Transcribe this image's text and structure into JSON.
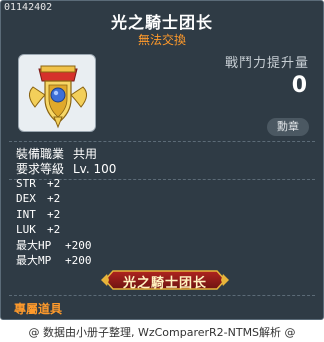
{
  "tooltip": {
    "item_code": "01142402",
    "title": "光之騎士团长",
    "trade_status": "無法交換",
    "power_label": "戰鬥力提升量",
    "power_value": "0",
    "badge_label": "勳章",
    "requirements": {
      "job_label": "裝備職業",
      "job_value": "共用",
      "level_label": "要求等級",
      "level_value": "Lv. 100"
    },
    "stats": [
      {
        "key": "STR",
        "value": "+2"
      },
      {
        "key": "DEX",
        "value": "+2"
      },
      {
        "key": "INT",
        "value": "+2"
      },
      {
        "key": "LUK",
        "value": "+2"
      },
      {
        "key": "最大HP",
        "value": "+200"
      },
      {
        "key": "最大MP",
        "value": "+200"
      }
    ],
    "title_plate_text": "光之騎士团长",
    "exclusive_label": "專屬道具"
  },
  "footer": {
    "credit": "@ 数据由小册子整理, WzComparerR2-NTMS解析 @"
  },
  "colors": {
    "panel_bg": "#2f3b45",
    "accent_orange": "#ff9a2b",
    "text_white": "#ffffff"
  },
  "icons": {
    "item": "knight-medal-icon",
    "title_plate": "title-plate-emblem"
  }
}
